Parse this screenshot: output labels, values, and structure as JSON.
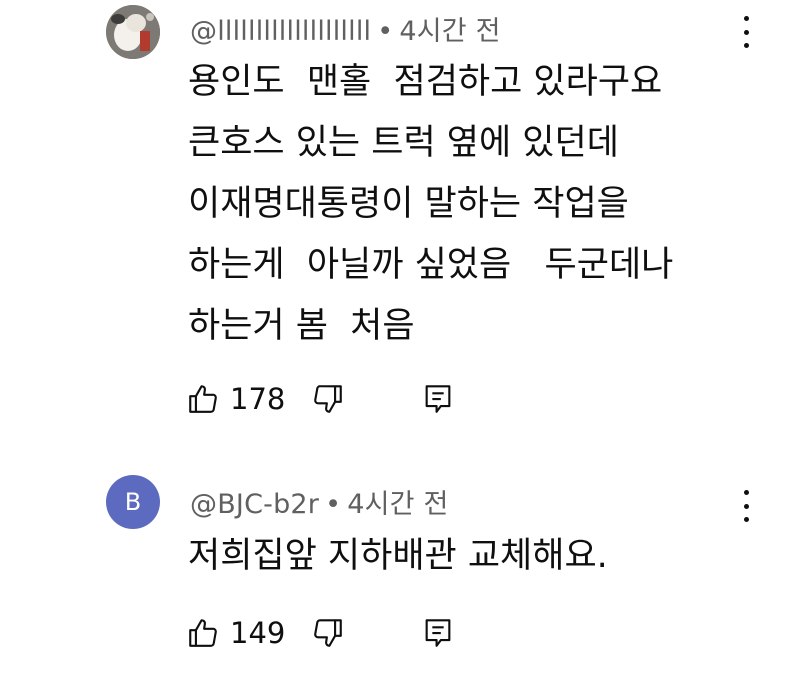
{
  "comments": [
    {
      "author": "@llllllllllllllllllll",
      "separator": "•",
      "time": "4시간 전",
      "text": "용인도  맨홀  점검하고 있라구요\n큰호스 있는 트럭 옆에 있던데\n이재명대통령이 말하는 작업을\n하는게  아닐까 싶었음   두군데나\n하는거 봄  처음",
      "likes": "178",
      "avatar": {
        "type": "photo",
        "icon": "user-photo"
      }
    },
    {
      "author": "@BJC-b2r",
      "separator": "•",
      "time": "4시간 전",
      "text": "저희집앞 지하배관 교체해요.",
      "likes": "149",
      "avatar": {
        "type": "letter",
        "letter": "B",
        "color": "#5c6bc0"
      }
    }
  ],
  "icons": {
    "like": "thumb-up-icon",
    "dislike": "thumb-down-icon",
    "reply": "reply-icon",
    "more": "more-vertical-icon"
  },
  "colors": {
    "meta_text": "#606060",
    "body_text": "#0f0f0f",
    "avatar_b": "#5c6bc0"
  }
}
